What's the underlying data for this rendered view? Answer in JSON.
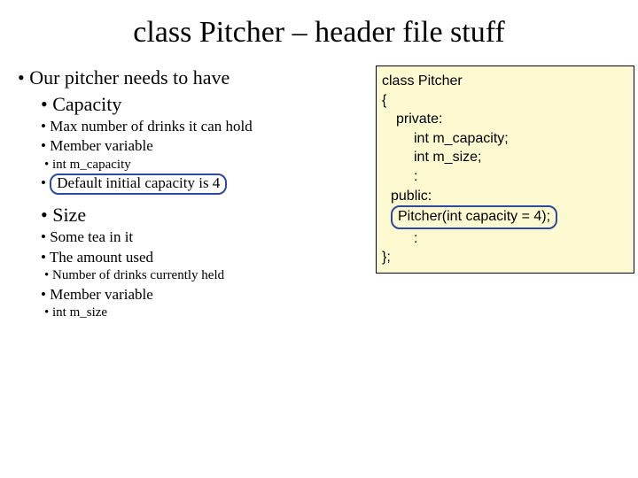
{
  "title": "class Pitcher – header file stuff",
  "left": {
    "l1": "Our pitcher needs to have",
    "capacity": {
      "label": "Capacity",
      "maxdrinks": "Max number of drinks it can hold",
      "member": "Member variable",
      "intcap": "int m_capacity",
      "default": "Default initial capacity is 4"
    },
    "size": {
      "label": "Size",
      "tea": "Some tea in it",
      "amount": "The amount used",
      "numheld": "Number of drinks currently held",
      "member": "Member variable",
      "intsize": "int m_size"
    }
  },
  "code": {
    "l1": "class Pitcher",
    "l2": "{",
    "l3": "private:",
    "l4": "int m_capacity;",
    "l5": "int m_size;",
    "l6": ":",
    "l7": "public:",
    "l8": "Pitcher(int capacity = 4);",
    "l9": ":",
    "l10": "};"
  }
}
